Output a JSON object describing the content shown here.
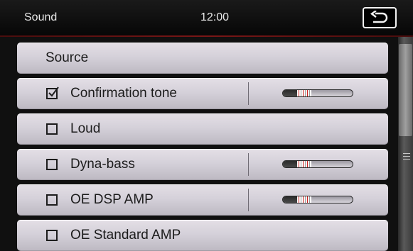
{
  "header": {
    "title": "Sound",
    "clock": "12:00",
    "back_icon": "return-arrow-icon"
  },
  "rows": [
    {
      "label": "Source",
      "has_checkbox": false,
      "checked": false,
      "has_slider": false
    },
    {
      "label": "Confirmation tone",
      "has_checkbox": true,
      "checked": true,
      "has_slider": true,
      "slider_level": 0.25
    },
    {
      "label": "Loud",
      "has_checkbox": true,
      "checked": false,
      "has_slider": false
    },
    {
      "label": "Dyna-bass",
      "has_checkbox": true,
      "checked": false,
      "has_slider": true,
      "slider_level": 0.25
    },
    {
      "label": "OE DSP AMP",
      "has_checkbox": true,
      "checked": false,
      "has_slider": true,
      "slider_level": 0.25
    },
    {
      "label": "OE Standard AMP",
      "has_checkbox": true,
      "checked": false,
      "has_slider": false
    }
  ],
  "scrollbar": {
    "position": 0.0,
    "visible_fraction": 0.5
  },
  "colors": {
    "background": "#0e0e0e",
    "row": "#d3cfd8",
    "accent_line": "#7a1616",
    "text_light": "#eaeaea",
    "text_dark": "#1c1c1c"
  }
}
